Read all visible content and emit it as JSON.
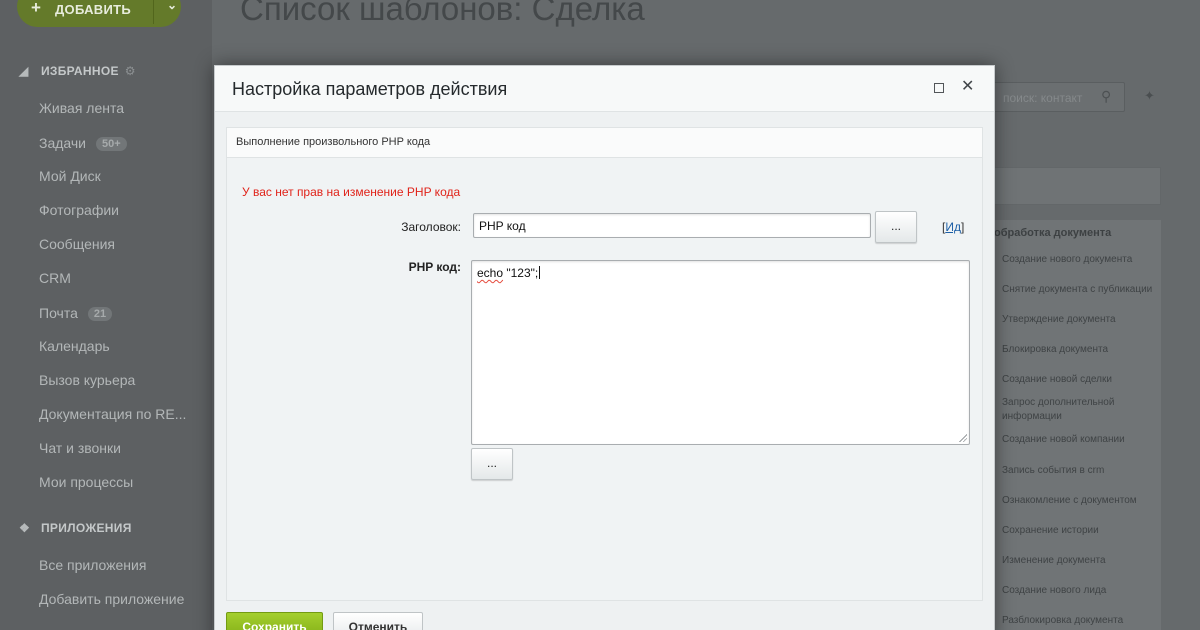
{
  "colors": {
    "accent_green": "#8fbc1e",
    "error_red": "#e0231a",
    "link_blue": "#1d5fa6"
  },
  "top": {
    "add_button": "ДОБАВИТЬ",
    "page_title": "Список шаблонов: Сделка",
    "search_placeholder": "поиск: контакт"
  },
  "sidebar": {
    "favorites_title": "ИЗБРАННОЕ",
    "items": [
      {
        "label": "Живая лента"
      },
      {
        "label": "Задачи",
        "badge": "50+"
      },
      {
        "label": "Мой Диск"
      },
      {
        "label": "Фотографии"
      },
      {
        "label": "Сообщения"
      },
      {
        "label": "CRM"
      },
      {
        "label": "Почта",
        "badge": "21"
      },
      {
        "label": "Календарь"
      },
      {
        "label": "Вызов курьера"
      },
      {
        "label": "Документация по RE..."
      },
      {
        "label": "Чат и звонки"
      },
      {
        "label": "Мои процессы"
      }
    ],
    "apps_title": "ПРИЛОЖЕНИЯ",
    "app_items": [
      {
        "label": "Все приложения"
      },
      {
        "label": "Добавить приложение"
      }
    ]
  },
  "right_panel": {
    "title": "обработка документа",
    "items": [
      "Создание нового документа",
      "Снятие документа с публикации",
      "Утверждение документа",
      "Блокировка документа",
      "Создание новой сделки",
      "Запрос дополнительной информации",
      "Создание новой компании",
      "Запись события в crm",
      "Ознакомление с документом",
      "Сохранение истории",
      "Изменение документа",
      "Создание нового лида",
      "Разблокировка документа"
    ]
  },
  "dialog": {
    "title": "Настройка параметров действия",
    "section_title": "Выполнение произвольного PHP кода",
    "error": "У вас нет прав на изменение PHP кода",
    "title_label": "Заголовок:",
    "title_value": "PHP код",
    "dots": "...",
    "id_link": "Ид",
    "code_label": "PHP код:",
    "code_keyword": "echo",
    "code_rest": " \"123\";",
    "save": "Сохранить",
    "cancel": "Отменить"
  }
}
